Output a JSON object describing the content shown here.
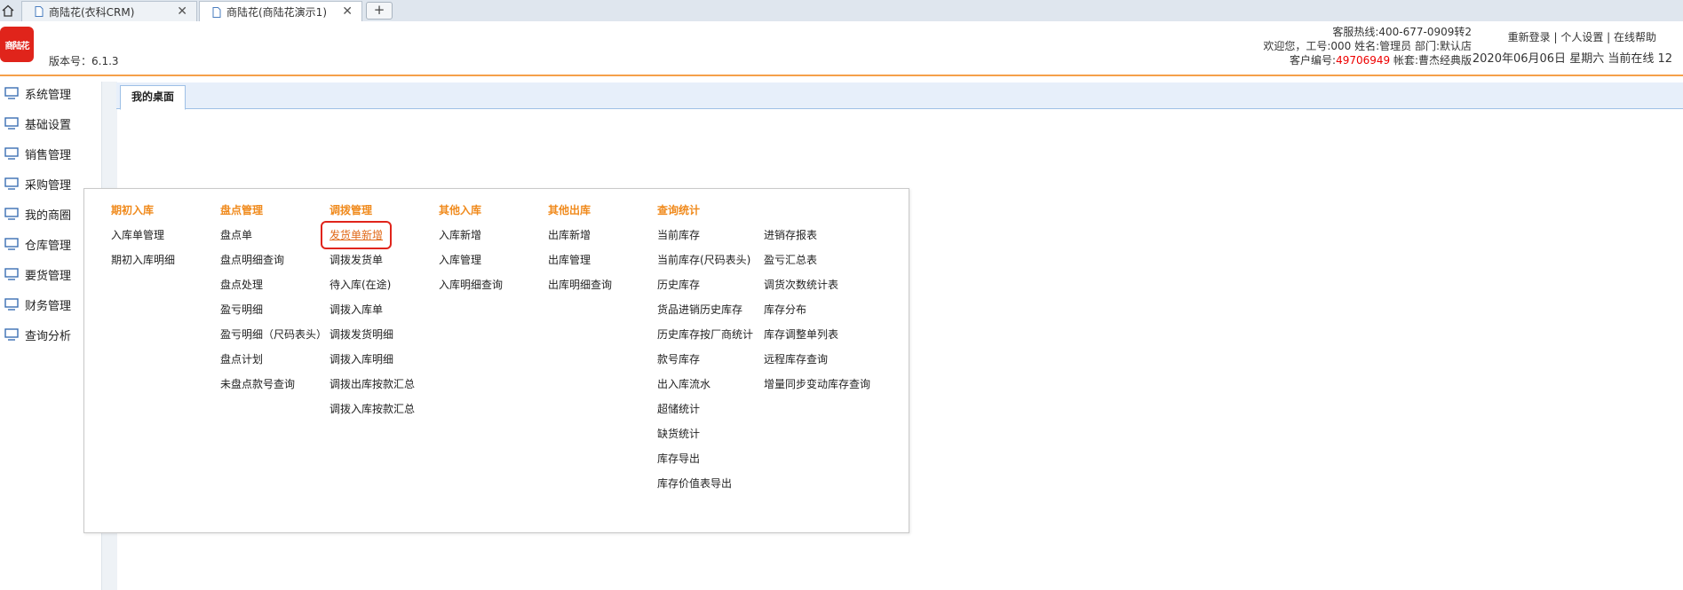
{
  "browser": {
    "tabs": [
      {
        "label": "商陆花(衣科CRM)",
        "active": false
      },
      {
        "label": "商陆花(商陆花演示1)",
        "active": true
      }
    ],
    "new_tab_label": "+"
  },
  "header": {
    "logo_text": "商陆花",
    "version": "版本号：6.1.3",
    "hotline": "客服热线:400-677-0909转2",
    "welcome": "欢迎您，工号:000 姓名:管理员 部门:默认店",
    "customer_label": "客户编号:",
    "customer_no": "49706949",
    "account": " 帐套:曹杰经典版",
    "links": "重新登录 | 个人设置 | 在线帮助",
    "datetime": "2020年06月06日 星期六 当前在线 12"
  },
  "sidebar": {
    "items": [
      {
        "label": "系统管理"
      },
      {
        "label": "基础设置"
      },
      {
        "label": "销售管理"
      },
      {
        "label": "采购管理"
      },
      {
        "label": "我的商圈"
      },
      {
        "label": "仓库管理"
      },
      {
        "label": "要货管理"
      },
      {
        "label": "财务管理"
      },
      {
        "label": "查询分析"
      }
    ]
  },
  "content": {
    "tab_label": "我的桌面"
  },
  "menu": {
    "columns": [
      {
        "head": "期初入库",
        "items": [
          "入库单管理",
          "期初入库明细"
        ]
      },
      {
        "head": "盘点管理",
        "items": [
          "盘点单",
          "盘点明细查询",
          "盘点处理",
          "盈亏明细",
          "盈亏明细（尺码表头）",
          "盘点计划",
          "未盘点款号查询"
        ]
      },
      {
        "head": "调拨管理",
        "items": [
          "发货单新增",
          "调拨发货单",
          "待入库(在途)",
          "调拨入库单",
          "调拨发货明细",
          "调拨入库明细",
          "调拨出库按款汇总",
          "调拨入库按款汇总"
        ]
      },
      {
        "head": "其他入库",
        "items": [
          "入库新增",
          "入库管理",
          "入库明细查询"
        ]
      },
      {
        "head": "其他出库",
        "items": [
          "出库新增",
          "出库管理",
          "出库明细查询"
        ]
      },
      {
        "head": "查询统计",
        "items": [
          "当前库存",
          "当前库存(尺码表头)",
          "历史库存",
          "货品进销历史库存",
          "历史库存按厂商统计",
          "款号库存",
          "出入库流水",
          "超储统计",
          "缺货统计",
          "库存导出",
          "库存价值表导出"
        ]
      },
      {
        "head": "",
        "items": [
          "进销存报表",
          "盈亏汇总表",
          "调货次数统计表",
          "库存分布",
          "库存调整单列表",
          "远程库存查询",
          "增量同步变动库存查询"
        ]
      }
    ]
  },
  "colors": {
    "accent_orange": "#f08a1c",
    "highlight_red": "#e0241b",
    "customer_no_red": "#ee0000"
  }
}
